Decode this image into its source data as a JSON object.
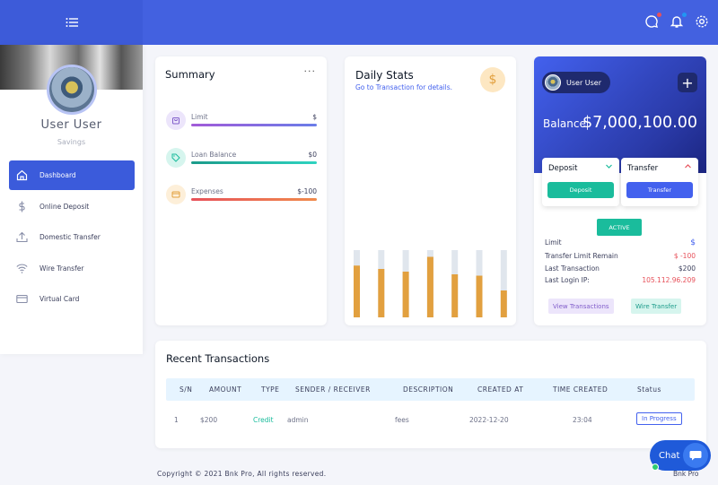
{
  "colors": {
    "primary": "#4361ee",
    "sidebar_active": "#3b5bdb",
    "success": "#1abc9c",
    "danger": "#e7515a",
    "warning": "#e2a03f"
  },
  "topbar": {
    "menu_icon": "hamburger-icon",
    "icons": [
      "chat-icon",
      "bell-icon",
      "gear-icon"
    ]
  },
  "sidebar": {
    "user_name": "User User",
    "account_type": "Savings",
    "items": [
      {
        "label": "Dashboard",
        "icon": "home-icon"
      },
      {
        "label": "Online Deposit",
        "icon": "dollar-icon"
      },
      {
        "label": "Domestic Transfer",
        "icon": "upload-icon"
      },
      {
        "label": "Wire Transfer",
        "icon": "wifi-icon"
      },
      {
        "label": "Virtual Card",
        "icon": "card-icon"
      }
    ]
  },
  "summary": {
    "title": "Summary",
    "menu": "···",
    "rows": [
      {
        "label": "Limit",
        "value": "$",
        "icon": "bag-icon"
      },
      {
        "label": "Loan Balance",
        "value": "$0",
        "icon": "tag-icon"
      },
      {
        "label": "Expenses",
        "value": "$-100",
        "icon": "credit-card-icon"
      }
    ]
  },
  "daily": {
    "title": "Daily Stats",
    "subtitle": "Go to Transaction for details.",
    "badge": "$",
    "bar_levels": [
      0.77,
      0.72,
      0.68,
      0.9,
      0.64,
      0.62,
      0.4
    ]
  },
  "balance": {
    "user_label": "User User",
    "plus": "+",
    "label": "Balance",
    "amount": "$7,000,100.00",
    "deposit": {
      "label": "Deposit",
      "button": "Deposit"
    },
    "transfer": {
      "label": "Transfer",
      "button": "Transfer"
    },
    "status": "ACTIVE",
    "info": [
      {
        "label": "Limit",
        "value": "$"
      },
      {
        "label": "Transfer Limit Remain",
        "value": "$ -100"
      },
      {
        "label": "Last Transaction",
        "value": "$200"
      },
      {
        "label": "Last Login IP:",
        "value": "105.112.96.209"
      }
    ],
    "view_transactions": "View Transactions",
    "wire_transfer": "Wire Transfer"
  },
  "transactions": {
    "title": "Recent Transactions",
    "headers": [
      "S/N",
      "AMOUNT",
      "TYPE",
      "SENDER / RECEIVER",
      "DESCRIPTION",
      "CREATED AT",
      "TIME CREATED",
      "Status"
    ],
    "rows": [
      {
        "sn": "1",
        "amount": "$200",
        "type": "Credit",
        "party": "admin",
        "description": "fees",
        "created_at": "2022-12-20",
        "time": "23:04",
        "status": "In Progress"
      }
    ]
  },
  "footer": {
    "copyright": "Copyright © 2021 Bnk Pro, All rights reserved.",
    "brand": "Bnk Pro"
  },
  "chat": {
    "label": "Chat"
  }
}
